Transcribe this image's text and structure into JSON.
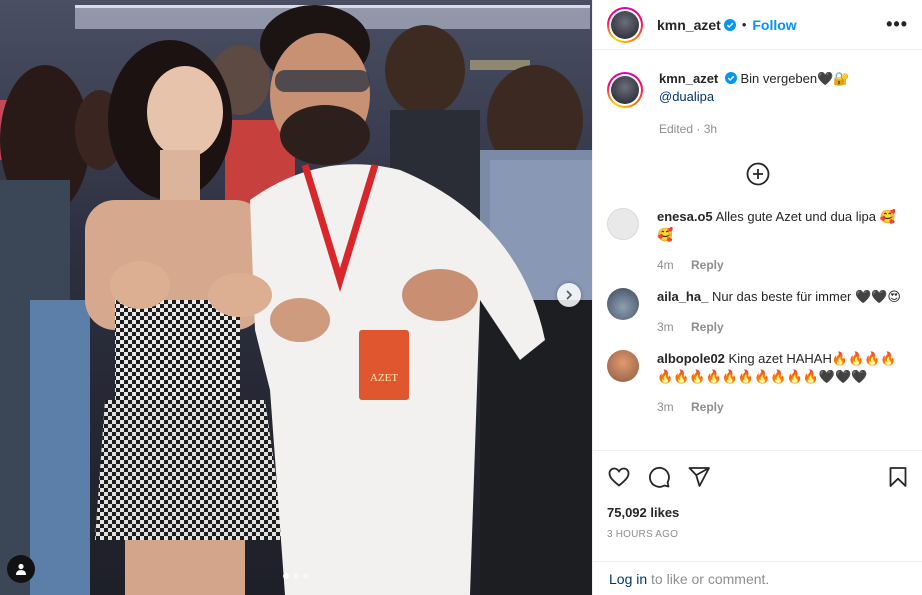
{
  "post": {
    "author": "kmn_azet",
    "follow_label": "Follow",
    "bullet": "•",
    "more_label": "•••",
    "caption": {
      "text": "Bin vergeben🖤🔐",
      "mention": "@dualipa",
      "edited": "Edited",
      "time": "3h"
    },
    "comments": [
      {
        "user": "enesa.o5",
        "text": "Alles gute Azet und dua lipa 🥰 🥰",
        "time": "4m",
        "reply": "Reply"
      },
      {
        "user": "aila_ha_",
        "text": "Nur das beste für immer 🖤🖤😍",
        "time": "3m",
        "reply": "Reply"
      },
      {
        "user": "albopole02",
        "text": "King azet HAHAH🔥🔥🔥🔥🔥🔥🔥🔥🔥🔥🔥🔥🔥🔥🖤🖤🖤",
        "time": "3m",
        "reply": "Reply"
      }
    ],
    "likes": "75,092 likes",
    "posted_ago": "3 HOURS AGO",
    "login_link": "Log in",
    "login_suffix": " to like or comment.",
    "carousel": {
      "slides": 3,
      "active": 0
    },
    "badge_text": "AZET",
    "icons": {
      "verified": "verified-badge-icon",
      "more": "more-options-icon",
      "add_comment": "plus-circle-icon",
      "like": "heart-icon",
      "comment": "comment-icon",
      "share": "paper-plane-icon",
      "save": "bookmark-icon",
      "next": "chevron-right-icon",
      "tag": "user-tag-icon"
    },
    "colors": {
      "accent": "#0095f6",
      "link": "#00376b",
      "muted": "#8e8e8e",
      "text": "#262626"
    }
  }
}
